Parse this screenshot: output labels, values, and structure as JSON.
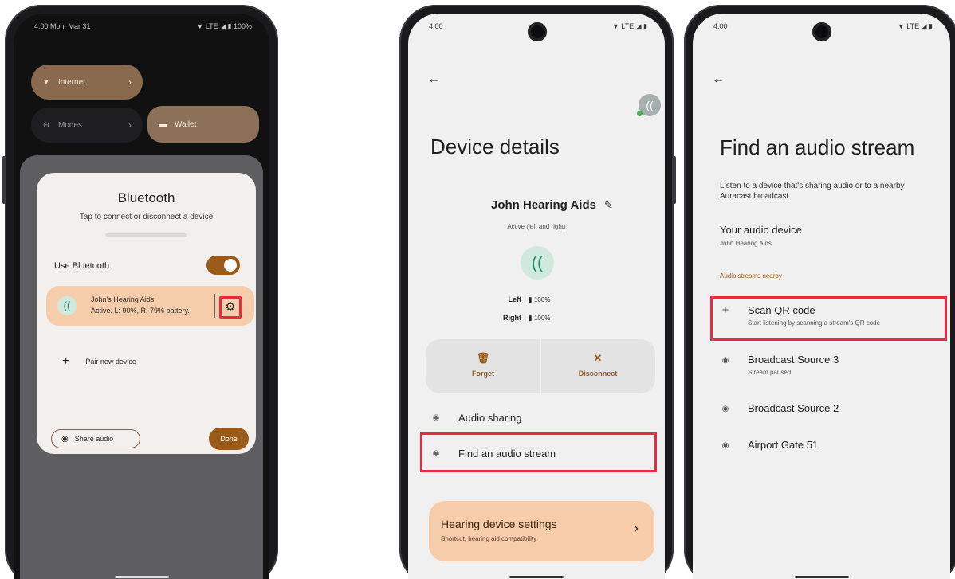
{
  "phone1": {
    "status": {
      "time_date": "4:00  Mon, Mar 31",
      "right": "▼ LTE ◢ ▮ 100%"
    },
    "tiles": {
      "internet": "Internet",
      "modes": "Modes",
      "wallet": "Wallet"
    },
    "dialog": {
      "title": "Bluetooth",
      "subtitle": "Tap to connect or disconnect a device",
      "use_label": "Use Bluetooth",
      "device_name": "John's Hearing Aids",
      "device_status": "Active. L: 90%, R: 79% battery.",
      "pair_label": "Pair new device",
      "share_label": "Share audio",
      "done_label": "Done"
    }
  },
  "phone2": {
    "status": {
      "time": "4:00",
      "right": "▼ LTE ◢ ▮"
    },
    "title": "Device details",
    "device_name": "John Hearing Aids",
    "device_status": "Active (left and right)",
    "battery": [
      {
        "side": "Left",
        "value": "100%"
      },
      {
        "side": "Right",
        "value": "100%"
      }
    ],
    "actions": {
      "forget": "Forget",
      "disconnect": "Disconnect"
    },
    "rows": {
      "audio_sharing": "Audio sharing",
      "find_stream": "Find an audio stream"
    },
    "hearing_settings": {
      "title": "Hearing device settings",
      "subtitle": "Shortcut, hearing aid compatibility"
    }
  },
  "phone3": {
    "status": {
      "time": "4:00",
      "right": "▼ LTE ◢ ▮"
    },
    "title": "Find an audio stream",
    "description": "Listen to a device that's sharing audio or to a nearby Auracast broadcast",
    "your_device_heading": "Your audio device",
    "your_device_name": "John Hearing Aids",
    "nearby_heading": "Audio streams nearby",
    "scan": {
      "title": "Scan QR code",
      "subtitle": "Start listening by scanning a stream's QR code"
    },
    "streams": [
      {
        "title": "Broadcast Source 3",
        "subtitle": "Stream paused"
      },
      {
        "title": "Broadcast Source 2",
        "subtitle": ""
      },
      {
        "title": "Airport Gate 51",
        "subtitle": ""
      }
    ]
  },
  "colors": {
    "accent": "#9a5a18",
    "highlight": "#e8293e",
    "device_row": "#f5cdab",
    "hearing_av": "#cfe9de"
  },
  "icons": [
    "wifi-icon",
    "modes-icon",
    "wallet-icon",
    "hearing-aid-icon",
    "gear-icon",
    "plus-icon",
    "share-audio-icon",
    "back-arrow-icon",
    "edit-icon",
    "battery-icon",
    "trash-icon",
    "close-icon",
    "broadcast-icon",
    "chevron-right-icon"
  ]
}
